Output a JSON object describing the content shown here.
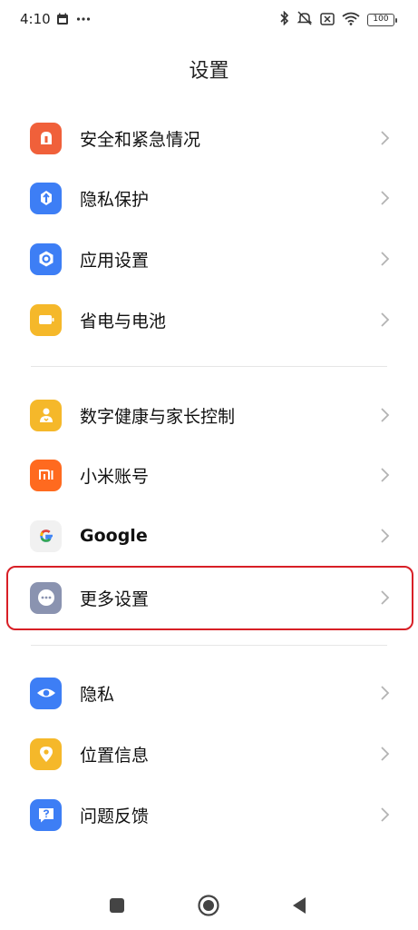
{
  "status_bar": {
    "time": "4:10",
    "battery": "100",
    "left_icons": [
      "calendar-icon",
      "more-dots-icon"
    ],
    "right_icons": [
      "bluetooth-icon",
      "mute-vibrate-icon",
      "no-sim-icon",
      "wifi-icon",
      "battery-icon"
    ]
  },
  "header": {
    "title": "设置"
  },
  "sections": [
    {
      "items": [
        {
          "label": "安全和紧急情况",
          "icon": "emergency-icon",
          "color": "#f0603a"
        },
        {
          "label": "隐私保护",
          "icon": "privacy-protection-icon",
          "color": "#3d7ef5"
        },
        {
          "label": "应用设置",
          "icon": "app-settings-icon",
          "color": "#3d7ef5"
        },
        {
          "label": "省电与电池",
          "icon": "battery-saver-icon",
          "color": "#f5b82a"
        }
      ]
    },
    {
      "items": [
        {
          "label": "数字健康与家长控制",
          "icon": "digital-wellbeing-icon",
          "color": "#f5b82a"
        },
        {
          "label": "小米账号",
          "icon": "mi-account-icon",
          "color": "#ff6a1f"
        },
        {
          "label": "Google",
          "icon": "google-icon",
          "color": "#f1f1f1"
        },
        {
          "label": "更多设置",
          "icon": "more-settings-icon",
          "color": "#8a93b0",
          "highlighted": true
        }
      ]
    },
    {
      "items": [
        {
          "label": "隐私",
          "icon": "eye-icon",
          "color": "#3d7ef5"
        },
        {
          "label": "位置信息",
          "icon": "location-icon",
          "color": "#f5b82a"
        },
        {
          "label": "问题反馈",
          "icon": "feedback-icon",
          "color": "#3d7ef5"
        }
      ]
    }
  ],
  "nav_bar": {
    "buttons": [
      "recents-button",
      "home-button",
      "back-button"
    ]
  }
}
